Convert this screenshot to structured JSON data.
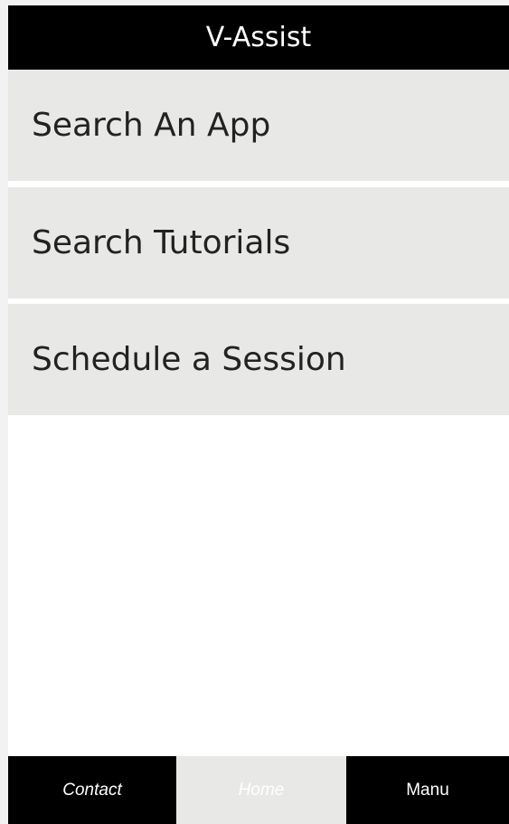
{
  "header": {
    "title": "V-Assist"
  },
  "menu": {
    "items": [
      {
        "label": "Search An App"
      },
      {
        "label": "Search Tutorials"
      },
      {
        "label": "Schedule a Session"
      }
    ]
  },
  "footer": {
    "tabs": [
      {
        "label": "Contact"
      },
      {
        "label": "Home",
        "active": true
      },
      {
        "label": "Manu"
      }
    ]
  },
  "colors": {
    "header_bg": "#000000",
    "menu_item_bg": "#e8e9e7",
    "footer_bg": "#000000",
    "active_tab_bg": "#e8e9e7"
  }
}
